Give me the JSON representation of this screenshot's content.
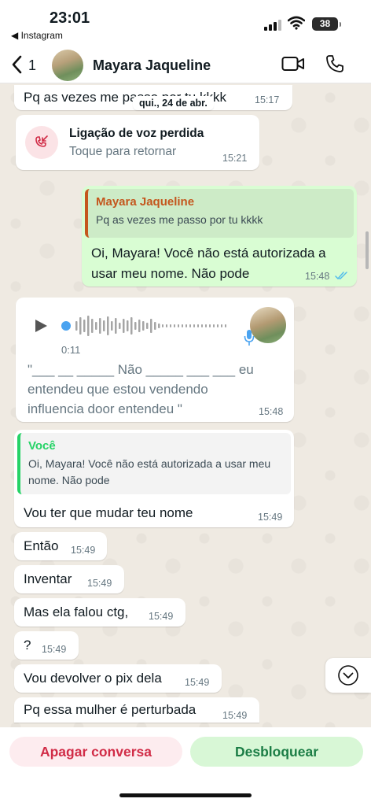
{
  "status_bar": {
    "time": "23:01",
    "back_app": "◀ Instagram",
    "battery": "38"
  },
  "header": {
    "back_count": "1",
    "contact_name": "Mayara Jaqueline"
  },
  "messages": {
    "m0_text": "Pq as vezes me passo por tu kkkk",
    "m0_time": "15:17",
    "date_chip": "qui., 24 de abr.",
    "call_title": "Ligação de voz perdida",
    "call_sub": "Toque para retornar",
    "call_time": "15:21",
    "reply1_quote_name": "Mayara Jaqueline",
    "reply1_quote_text": "Pq as vezes me passo por tu kkkk",
    "reply1_line1": "Oi, Mayara! Você não está autorizada a",
    "reply1_line2": "usar meu nome. Não pode",
    "reply1_time": "15:48",
    "voice_duration": "0:11",
    "voice_line1": "\"___ __ _____ Não _____ ___ ___ eu",
    "voice_line2": "entendeu que estou vendendo",
    "voice_line3": "influencia door entendeu \"",
    "voice_time": "15:48",
    "reply2_quote_name": "Você",
    "reply2_quote_line1": "Oi, Mayara! Você não está autorizada a usar meu",
    "reply2_quote_line2": "nome. Não pode",
    "reply2_text": "Vou ter que mudar teu nome",
    "reply2_time": "15:49",
    "s1": "Então",
    "s1_t": "15:49",
    "s2": "Inventar",
    "s2_t": "15:49",
    "s3": "Mas ela falou ctg,",
    "s3_t": "15:49",
    "s4": "?",
    "s4_t": "15:49",
    "s5": "Vou devolver o pix dela",
    "s5_t": "15:49",
    "s6": "Pq essa mulher é perturbada",
    "s6_t": "15:49"
  },
  "footer": {
    "delete_label": "Apagar conversa",
    "unblock_label": "Desbloquear"
  },
  "colors": {
    "outgoing_bubble": "#d9fdd3",
    "missed_call": "#d12c47",
    "read_ticks": "#53bdeb",
    "quote_other": "#c4561d",
    "quote_self": "#25d366"
  },
  "icons": {
    "back": "chevron-left-icon",
    "video": "video-call-icon",
    "phone": "phone-icon",
    "missed_call": "missed-call-icon",
    "play": "play-icon",
    "mic": "mic-icon",
    "scroll": "chevron-down-icon"
  }
}
